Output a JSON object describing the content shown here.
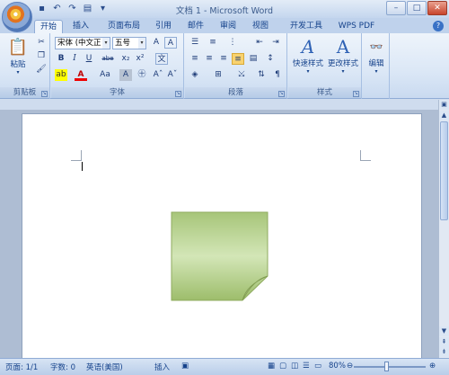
{
  "titlebar": {
    "title": "文档 1 - Microsoft Word",
    "qat": [
      "save-icon",
      "undo-icon",
      "redo-icon",
      "print-preview-icon",
      "customize-icon"
    ],
    "controls": {
      "minimize": "–",
      "maximize": "□",
      "close": "✕"
    }
  },
  "tabs": [
    "开始",
    "插入",
    "页面布局",
    "引用",
    "邮件",
    "审阅",
    "视图",
    "开发工具",
    "WPS PDF"
  ],
  "active_tab": "开始",
  "ribbon": {
    "clipboard": {
      "label": "剪贴板",
      "paste": "粘贴"
    },
    "font": {
      "label": "字体",
      "font_name": "宋体 (中文正文)",
      "font_size": "五号",
      "change_case": "Aa"
    },
    "paragraph": {
      "label": "段落"
    },
    "styles": {
      "label": "样式",
      "quick_styles": "快速样式",
      "change_styles": "更改样式"
    },
    "editing": {
      "label": "编辑",
      "edit": "编辑"
    }
  },
  "statusbar": {
    "page": "页面: 1/1",
    "words": "字数: 0",
    "language": "英语(美国)",
    "insert": "插入",
    "zoom": "80%"
  },
  "colors": {
    "note_fill": "#a6c374",
    "note_edge": "#7f9b4f",
    "ribbon_bg": "#dbe7f6"
  }
}
